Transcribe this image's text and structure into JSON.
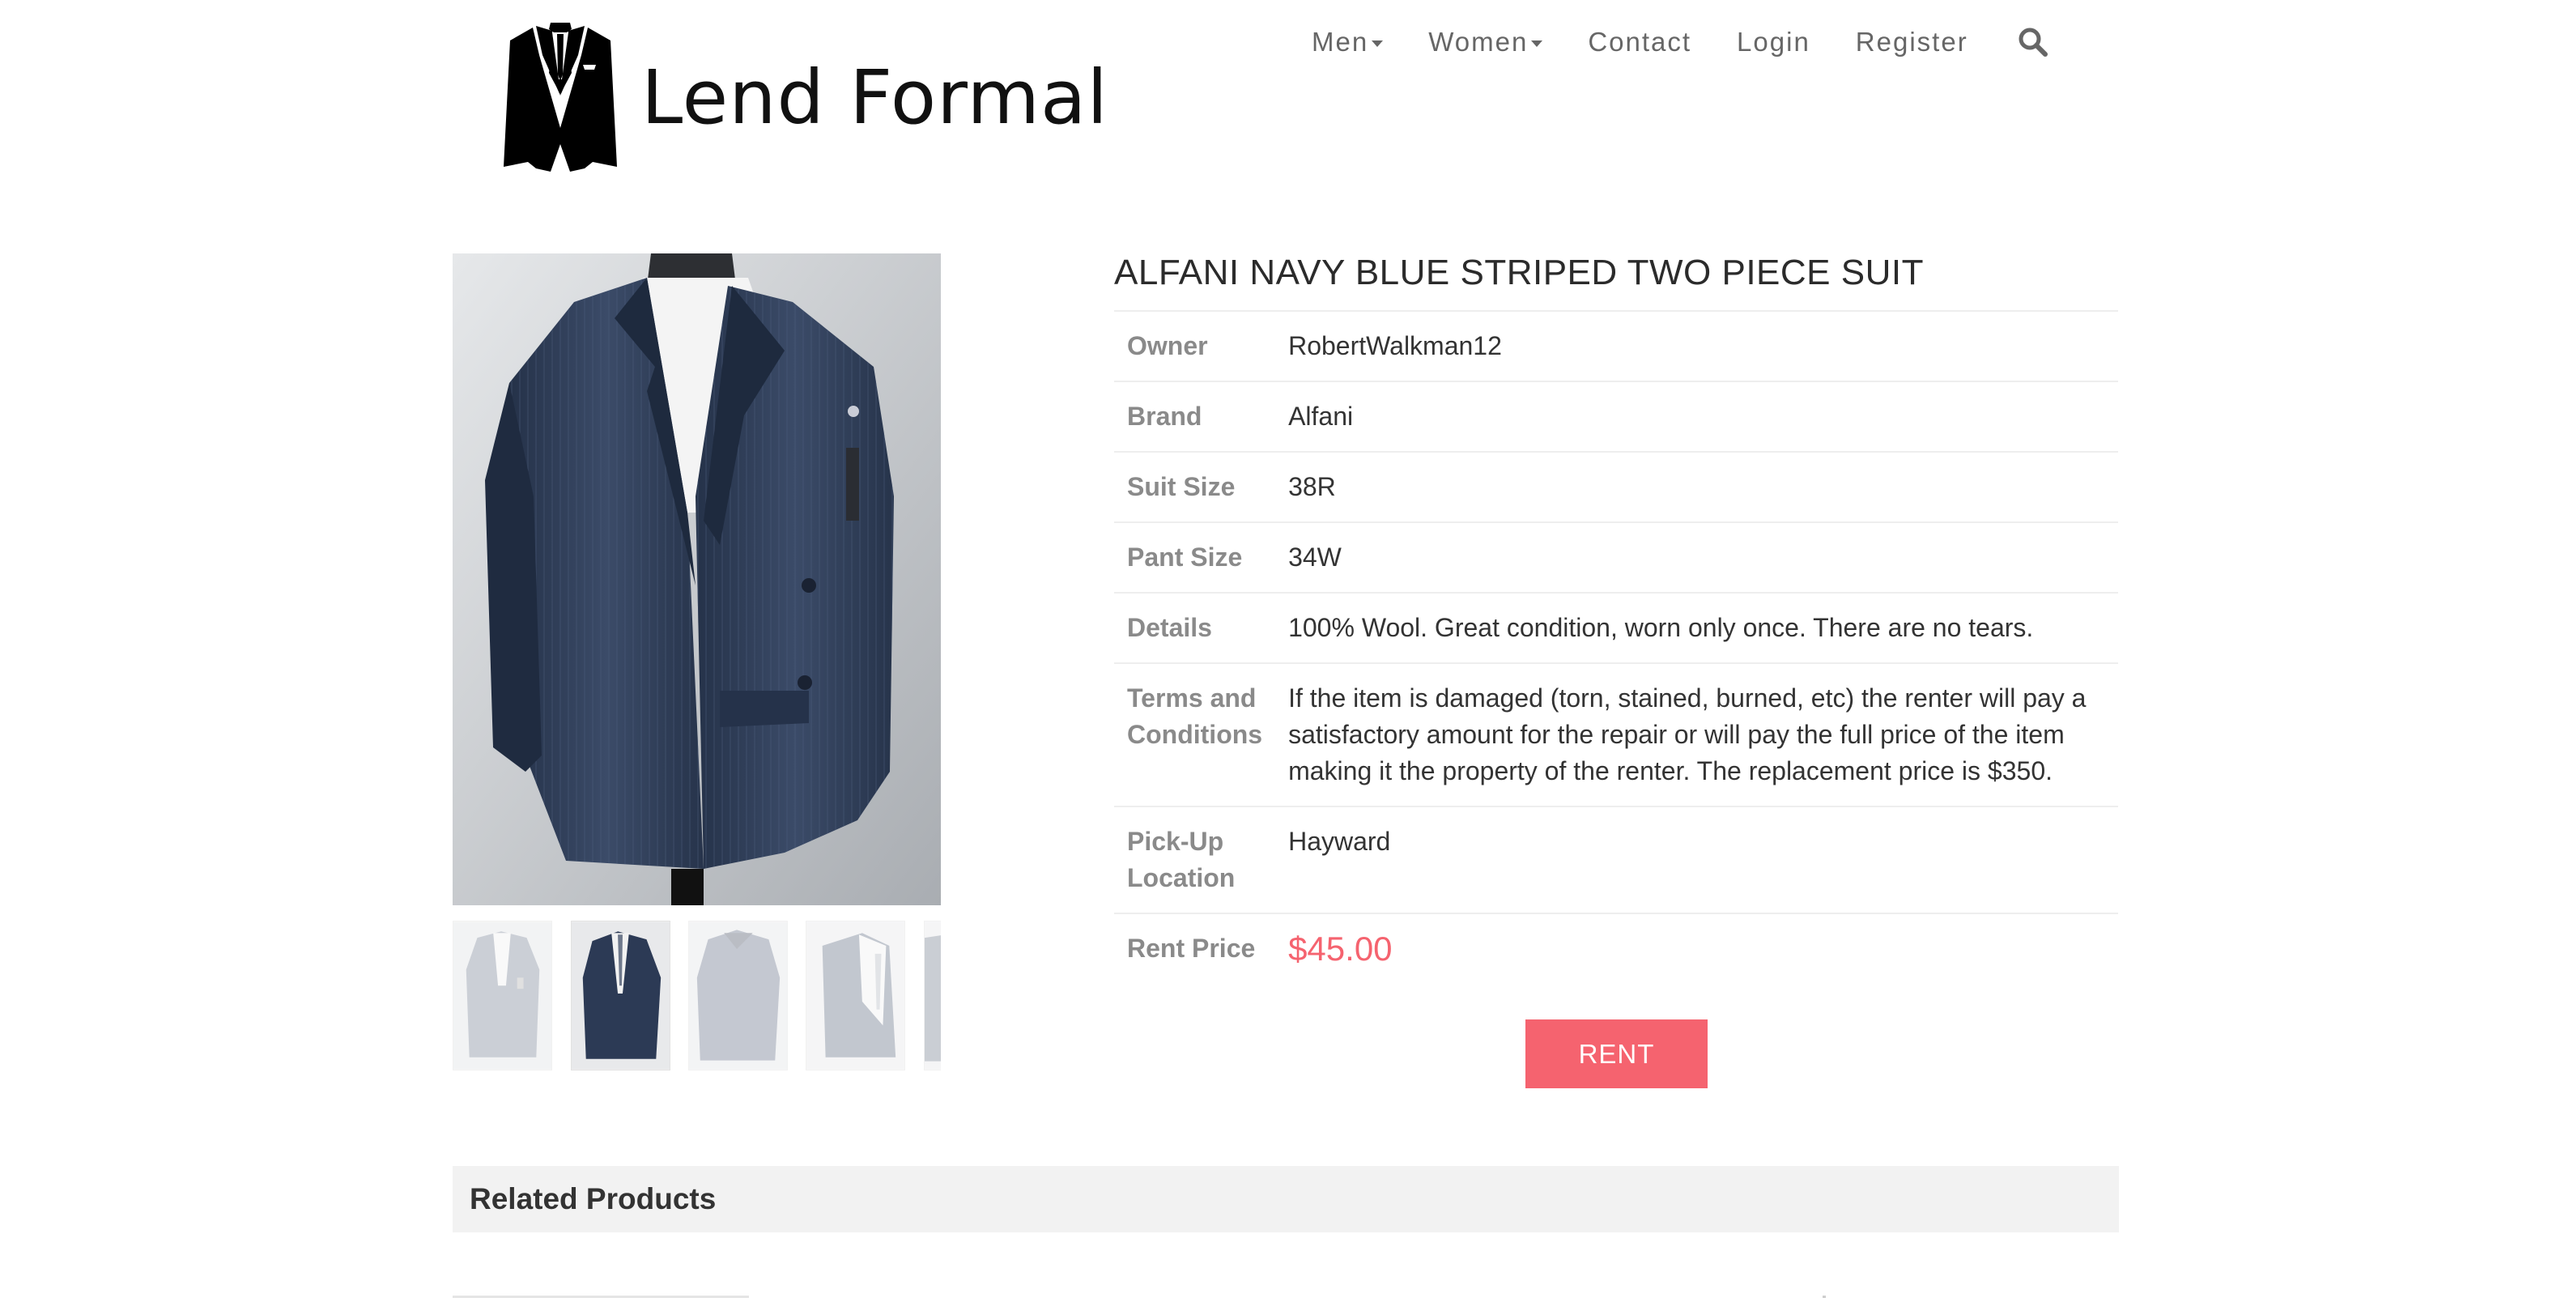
{
  "brand": {
    "name": "Lend Formal",
    "logo_icon": "tuxedo-jacket-icon"
  },
  "nav": {
    "items": [
      {
        "label": "Men",
        "dropdown": true
      },
      {
        "label": "Women",
        "dropdown": true
      },
      {
        "label": "Contact",
        "dropdown": false
      },
      {
        "label": "Login",
        "dropdown": false
      },
      {
        "label": "Register",
        "dropdown": false
      }
    ],
    "search_icon": "search-icon"
  },
  "product": {
    "title": "ALFANI NAVY BLUE STRIPED TWO PIECE SUIT",
    "details": [
      {
        "label": "Owner",
        "value": "RobertWalkman12"
      },
      {
        "label": "Brand",
        "value": "Alfani"
      },
      {
        "label": "Suit Size",
        "value": "38R"
      },
      {
        "label": "Pant Size",
        "value": "34W"
      },
      {
        "label": "Details",
        "value": "100% Wool. Great condition, worn only once. There are no tears."
      },
      {
        "label": "Terms and Conditions",
        "value": "If the item is damaged (torn, stained, burned, etc) the renter will pay a satisfactory amount for the repair or will pay the full price of the item making it the property of the renter. The replacement price is $350."
      },
      {
        "label": "Pick-Up Location",
        "value": "Hayward"
      },
      {
        "label": "Rent Price",
        "value": "$45.00"
      }
    ],
    "rent_button": "RENT",
    "thumbnail_count": 5,
    "active_thumbnail": 2
  },
  "related": {
    "title": "Related Products"
  },
  "colors": {
    "accent": "#f5636f",
    "suit": "#2f3d56",
    "related_bg": "#f2f2f2"
  }
}
